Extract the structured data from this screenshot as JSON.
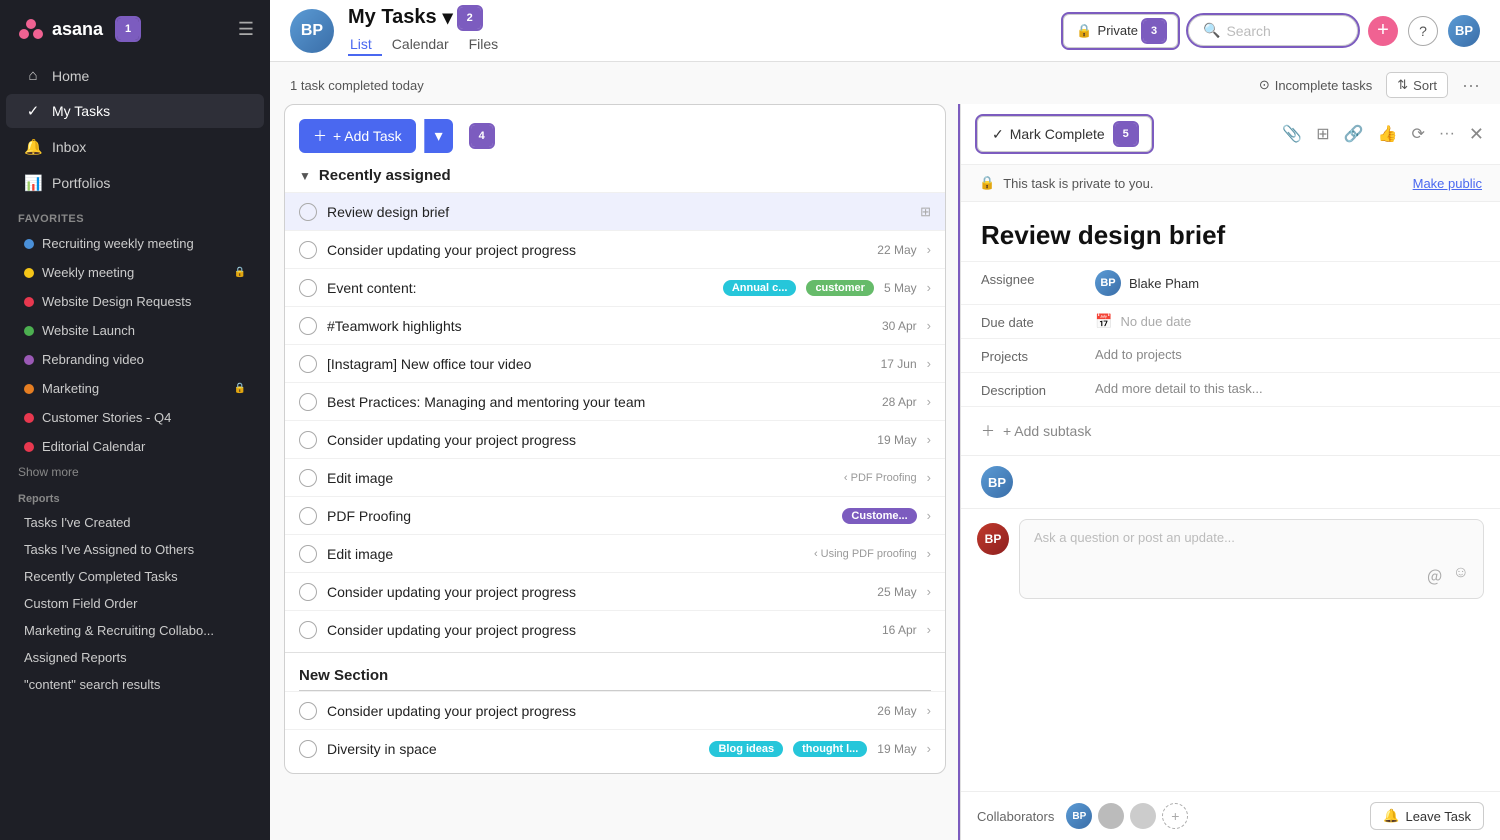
{
  "sidebar": {
    "logo_text": "asana",
    "badge_1": "1",
    "nav": [
      {
        "id": "home",
        "icon": "⌂",
        "label": "Home"
      },
      {
        "id": "my-tasks",
        "icon": "✓",
        "label": "My Tasks",
        "active": true
      },
      {
        "id": "inbox",
        "icon": "🔔",
        "label": "Inbox"
      },
      {
        "id": "portfolios",
        "icon": "📊",
        "label": "Portfolios"
      }
    ],
    "favorites_label": "Favorites",
    "favorites": [
      {
        "label": "Recruiting weekly meeting",
        "dot_class": "dot-blue",
        "lock": false
      },
      {
        "label": "Weekly meeting",
        "dot_class": "dot-yellow",
        "lock": true
      },
      {
        "label": "Website Design Requests",
        "dot_class": "dot-red",
        "lock": false
      },
      {
        "label": "Website Launch",
        "dot_class": "dot-green",
        "lock": false
      },
      {
        "label": "Rebranding video",
        "dot_class": "dot-purple",
        "lock": false
      },
      {
        "label": "Marketing",
        "dot_class": "dot-orange",
        "lock": true
      },
      {
        "label": "Customer Stories - Q4",
        "dot_class": "dot-red",
        "lock": false
      },
      {
        "label": "Editorial Calendar",
        "dot_class": "dot-red",
        "lock": false
      }
    ],
    "show_more": "Show more",
    "reports_label": "Reports",
    "reports": [
      {
        "label": "Tasks I've Created"
      },
      {
        "label": "Tasks I've Assigned to Others"
      },
      {
        "label": "Recently Completed Tasks"
      },
      {
        "label": "Custom Field Order"
      },
      {
        "label": "Marketing & Recruiting Collabo..."
      },
      {
        "label": "Assigned Reports"
      },
      {
        "label": "\"content\" search results"
      }
    ]
  },
  "topbar": {
    "badge_2": "2",
    "title": "My Tasks",
    "tabs": [
      "List",
      "Calendar",
      "Files"
    ],
    "active_tab": "List",
    "completed_today": "1 task completed today",
    "private_label": "Private",
    "search_placeholder": "Search",
    "badge_3": "3",
    "incomplete_tasks_label": "Incomplete tasks",
    "sort_label": "Sort"
  },
  "task_list": {
    "add_task_label": "+ Add Task",
    "badge_4": "4",
    "section_recently_assigned": "Recently assigned",
    "tasks": [
      {
        "id": 1,
        "name": "Review design brief",
        "date": "",
        "tags": [],
        "selected": true,
        "sub": ""
      },
      {
        "id": 2,
        "name": "Consider updating your project progress",
        "date": "22 May",
        "tags": [],
        "sub": ""
      },
      {
        "id": 3,
        "name": "Event content:",
        "date": "5 May",
        "tags": [
          {
            "label": "Annual c...",
            "class": "tag-teal"
          },
          {
            "label": "customer",
            "class": "tag-green"
          }
        ],
        "sub": ""
      },
      {
        "id": 4,
        "name": "#Teamwork highlights",
        "date": "30 Apr",
        "tags": [],
        "sub": ""
      },
      {
        "id": 5,
        "name": "[Instagram] New office tour video",
        "date": "17 Jun",
        "tags": [],
        "sub": ""
      },
      {
        "id": 6,
        "name": "Best Practices: Managing and mentoring your team",
        "date": "28 Apr",
        "tags": [],
        "sub": ""
      },
      {
        "id": 7,
        "name": "Consider updating your project progress",
        "date": "19 May",
        "tags": [],
        "sub": ""
      },
      {
        "id": 8,
        "name": "Edit image",
        "date": "",
        "tags": [],
        "sub": "‹ PDF Proofing"
      },
      {
        "id": 9,
        "name": "PDF Proofing",
        "date": "",
        "tags": [
          {
            "label": "Custome...",
            "class": "tag-purple"
          }
        ],
        "sub": ""
      },
      {
        "id": 10,
        "name": "Edit image",
        "date": "",
        "tags": [],
        "sub": "‹ Using PDF proofing"
      },
      {
        "id": 11,
        "name": "Consider updating your project progress",
        "date": "25 May",
        "tags": [],
        "sub": ""
      },
      {
        "id": 12,
        "name": "Consider updating your project progress",
        "date": "16 Apr",
        "tags": [],
        "sub": ""
      }
    ],
    "new_section_label": "New Section",
    "new_section_tasks": [
      {
        "id": 13,
        "name": "Consider updating your project progress",
        "date": "26 May",
        "tags": [],
        "sub": ""
      },
      {
        "id": 14,
        "name": "Diversity in space",
        "date": "19 May",
        "tags": [
          {
            "label": "Blog ideas",
            "class": "tag-teal"
          },
          {
            "label": "thought l...",
            "class": "tag-teal"
          }
        ],
        "sub": ""
      }
    ]
  },
  "detail": {
    "badge_5": "5",
    "mark_complete_label": "Mark Complete",
    "private_notice": "This task is private to you.",
    "make_public_label": "Make public",
    "title": "Review design brief",
    "assignee_label": "Assignee",
    "assignee_name": "Blake Pham",
    "due_date_label": "Due date",
    "due_date_value": "No due date",
    "projects_label": "Projects",
    "projects_value": "Add to projects",
    "description_label": "Description",
    "description_placeholder": "Add more detail to this task...",
    "add_subtask_label": "+ Add subtask",
    "comment_placeholder": "Ask a question or post an update...",
    "collaborators_label": "Collaborators",
    "leave_task_label": "Leave Task"
  }
}
